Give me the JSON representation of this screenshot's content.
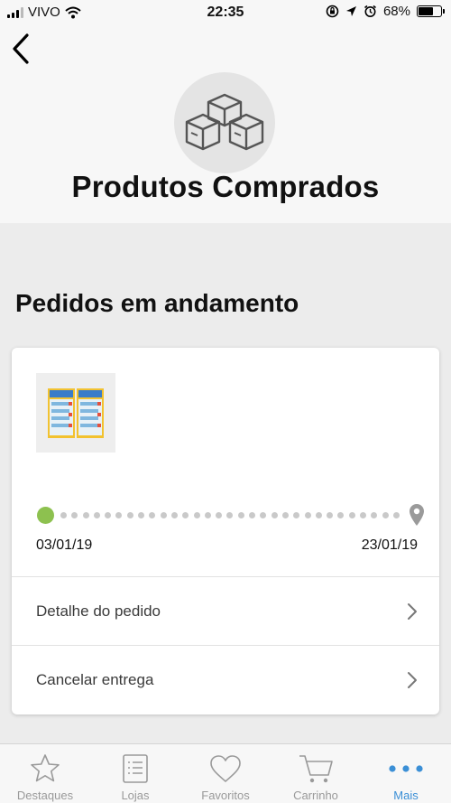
{
  "status_bar": {
    "carrier": "VIVO",
    "time": "22:35",
    "battery_percent": "68%",
    "battery_level": 0.68
  },
  "header": {
    "title": "Produtos Comprados",
    "hero_icon": "boxes-icon"
  },
  "section": {
    "title": "Pedidos em andamento"
  },
  "order": {
    "start_date": "03/01/19",
    "end_date": "23/01/19",
    "progress": 0,
    "rows": [
      {
        "label": "Detalhe do pedido"
      },
      {
        "label": "Cancelar entrega"
      }
    ]
  },
  "tabs": [
    {
      "label": "Destaques",
      "icon": "star-icon",
      "active": false
    },
    {
      "label": "Lojas",
      "icon": "list-icon",
      "active": false
    },
    {
      "label": "Favoritos",
      "icon": "heart-icon",
      "active": false
    },
    {
      "label": "Carrinho",
      "icon": "cart-icon",
      "active": false
    },
    {
      "label": "Mais",
      "icon": "more-icon",
      "active": true
    }
  ],
  "colors": {
    "accent": "#3b8fd6",
    "progress_start": "#8dc14f",
    "inactive": "#9a9a9a"
  }
}
